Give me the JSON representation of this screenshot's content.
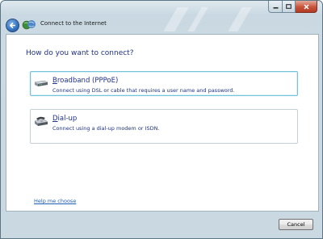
{
  "window": {
    "title": "Connect to the Internet",
    "caption_buttons": [
      "minimize",
      "maximize",
      "close"
    ]
  },
  "main": {
    "heading": "How do you want to connect?",
    "options": [
      {
        "title_underlined": "B",
        "title_rest": "roadband (PPPoE)",
        "description": "Connect using DSL or cable that requires a user name and password.",
        "icon": "broadband-modem-icon",
        "selected": true
      },
      {
        "title_underlined": "D",
        "title_rest": "ial-up",
        "description": "Connect using a dial-up modem or ISDN.",
        "icon": "dialup-phone-icon",
        "selected": false
      }
    ],
    "help_link": "Help me choose"
  },
  "footer": {
    "cancel_label": "Cancel"
  },
  "colors": {
    "heading": "#1e3287",
    "link": "#1f5fb8",
    "selected_border": "#74c2d8"
  }
}
